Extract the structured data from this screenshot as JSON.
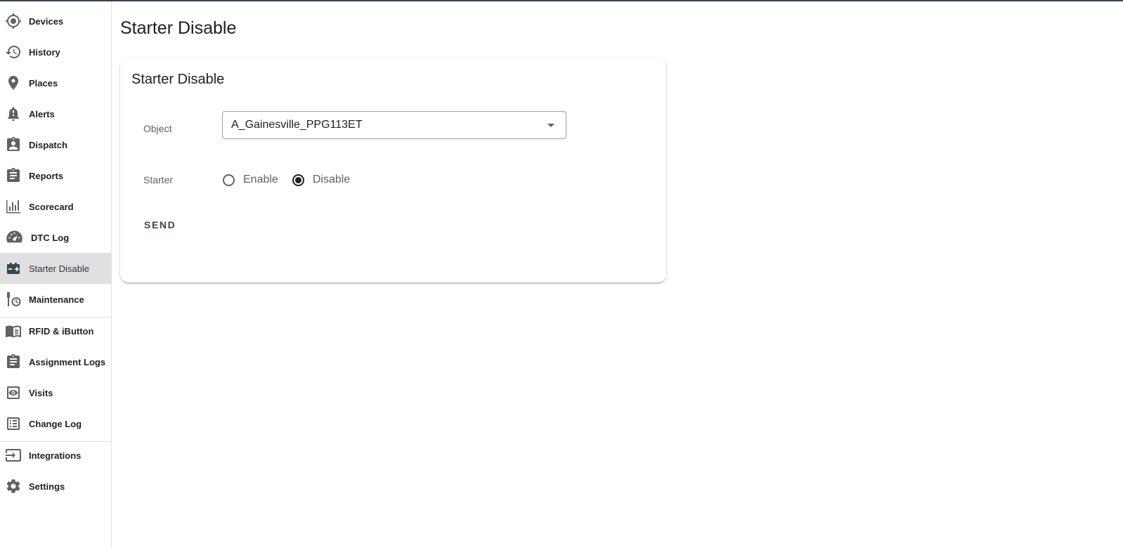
{
  "sidebar": {
    "items": [
      {
        "label": "Devices",
        "icon": "crosshair-icon"
      },
      {
        "label": "History",
        "icon": "history-icon"
      },
      {
        "label": "Places",
        "icon": "map-pin-icon"
      },
      {
        "label": "Alerts",
        "icon": "bell-alert-icon"
      },
      {
        "label": "Dispatch",
        "icon": "dispatch-icon"
      },
      {
        "label": "Reports",
        "icon": "clipboard-icon"
      },
      {
        "label": "Scorecard",
        "icon": "bar-chart-icon"
      },
      {
        "label": "DTC Log",
        "icon": "speedometer-icon"
      },
      {
        "label": "Starter Disable",
        "icon": "battery-icon",
        "active": true
      },
      {
        "label": "Maintenance",
        "icon": "wrench-clock-icon"
      },
      {
        "label": "RFID & iButton",
        "icon": "card-reader-icon"
      },
      {
        "label": "Assignment Logs",
        "icon": "clipboard-list-icon"
      },
      {
        "label": "Visits",
        "icon": "eye-icon"
      },
      {
        "label": "Change Log",
        "icon": "list-icon"
      },
      {
        "label": "Integrations",
        "icon": "import-icon"
      },
      {
        "label": "Settings",
        "icon": "gear-icon"
      }
    ]
  },
  "page": {
    "title": "Starter Disable"
  },
  "card": {
    "title": "Starter Disable",
    "object_label": "Object",
    "object_value": "A_Gainesville_PPG113ET",
    "starter_label": "Starter",
    "options": [
      {
        "label": "Enable",
        "checked": false
      },
      {
        "label": "Disable",
        "checked": true
      }
    ],
    "send_label": "SEND"
  },
  "colors": {
    "accent": "#37474f",
    "active_bg": "#e0e0e0",
    "text": "#212121",
    "muted": "#616161"
  }
}
